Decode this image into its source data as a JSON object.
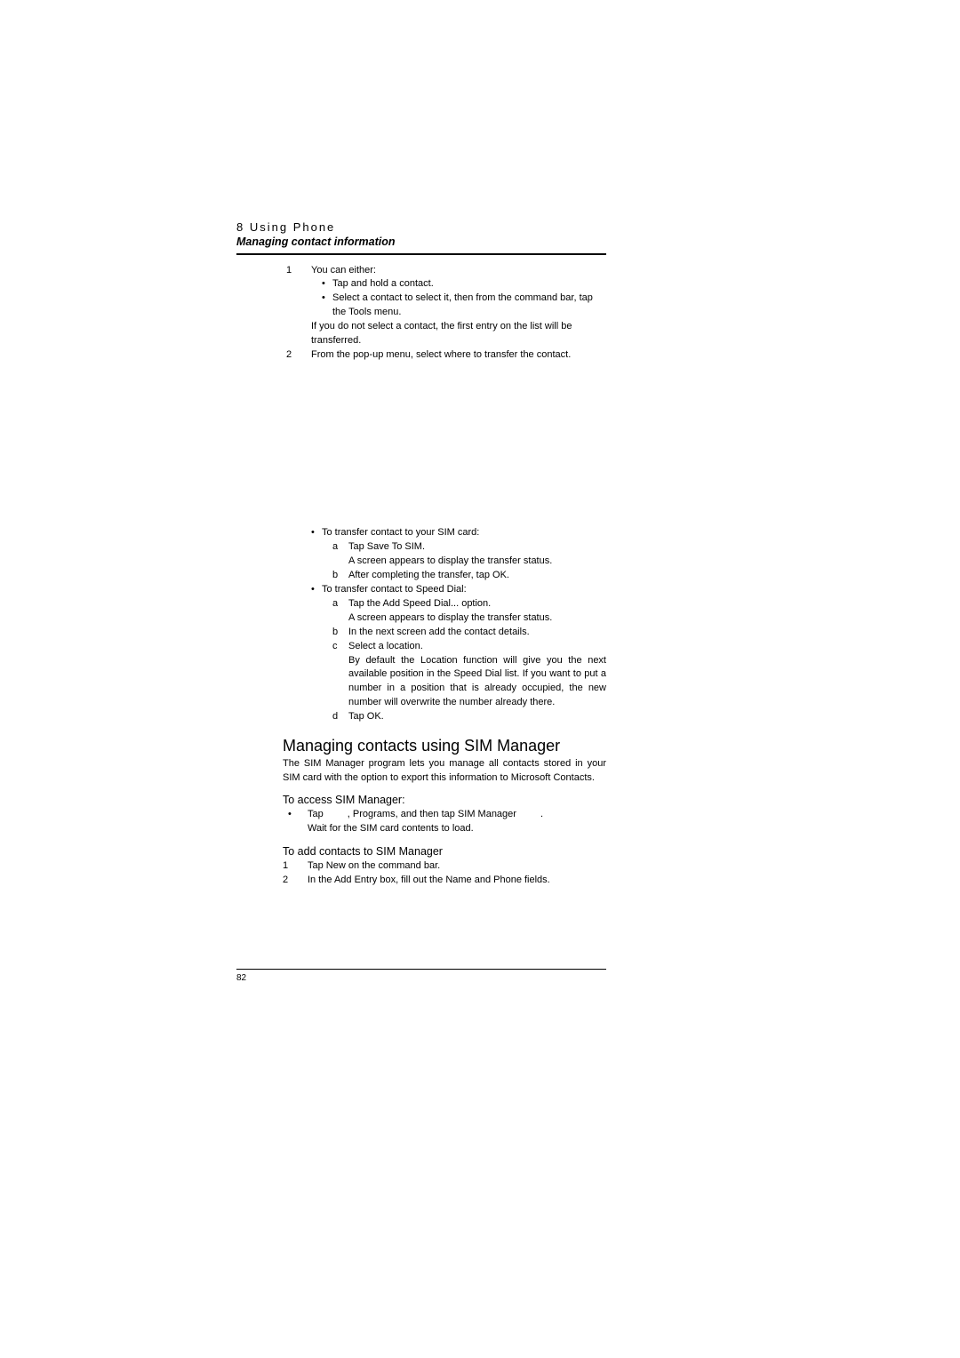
{
  "header": {
    "chapter": "8 Using Phone",
    "subtitle": "Managing contact information"
  },
  "step1": {
    "num": "1",
    "lead": "You can either:",
    "b1": "Tap and hold a contact.",
    "b2": "Select a contact to select it, then from the command bar, tap the Tools menu.",
    "note": "If you do not select a contact, the first entry on the list will be transferred."
  },
  "step2": {
    "num": "2",
    "text": "From the pop-up menu, select where to transfer the contact."
  },
  "sim": {
    "bullet": "To transfer contact to your SIM card:",
    "a_let": "a",
    "a_text": "Tap Save To SIM.",
    "a_sub": "A screen appears to display the transfer status.",
    "b_let": "b",
    "b_text": "After completing the transfer, tap OK."
  },
  "speed": {
    "bullet": "To transfer contact to Speed Dial:",
    "a_let": "a",
    "a_text": "Tap the Add Speed Dial... option.",
    "a_sub": "A screen appears to display the transfer status.",
    "b_let": "b",
    "b_text": "In the next screen add the contact details.",
    "c_let": "c",
    "c_text": "Select a location.",
    "c_sub": "By default the Location function will give you the next available position in the Speed Dial list. If you want to put a number in a position that is already occupied, the new number will overwrite the number already there.",
    "d_let": "d",
    "d_text": "Tap OK."
  },
  "section": {
    "title": "Managing contacts using SIM Manager",
    "intro": "The SIM Manager program lets you manage all contacts stored in your SIM card with the option to export this information to Microsoft Contacts.",
    "access_h": "To access SIM Manager:",
    "access_prefix": "Tap ",
    "access_mid": ", Programs, and then tap SIM Manager ",
    "access_suffix": ".",
    "access_line2": "Wait for the SIM card contents to load.",
    "add_h": "To add contacts to SIM Manager",
    "add1_num": "1",
    "add1": "Tap New on the command bar.",
    "add2_num": "2",
    "add2": "In the Add Entry box, fill out the Name and Phone fields."
  },
  "footer": {
    "page": "82"
  }
}
